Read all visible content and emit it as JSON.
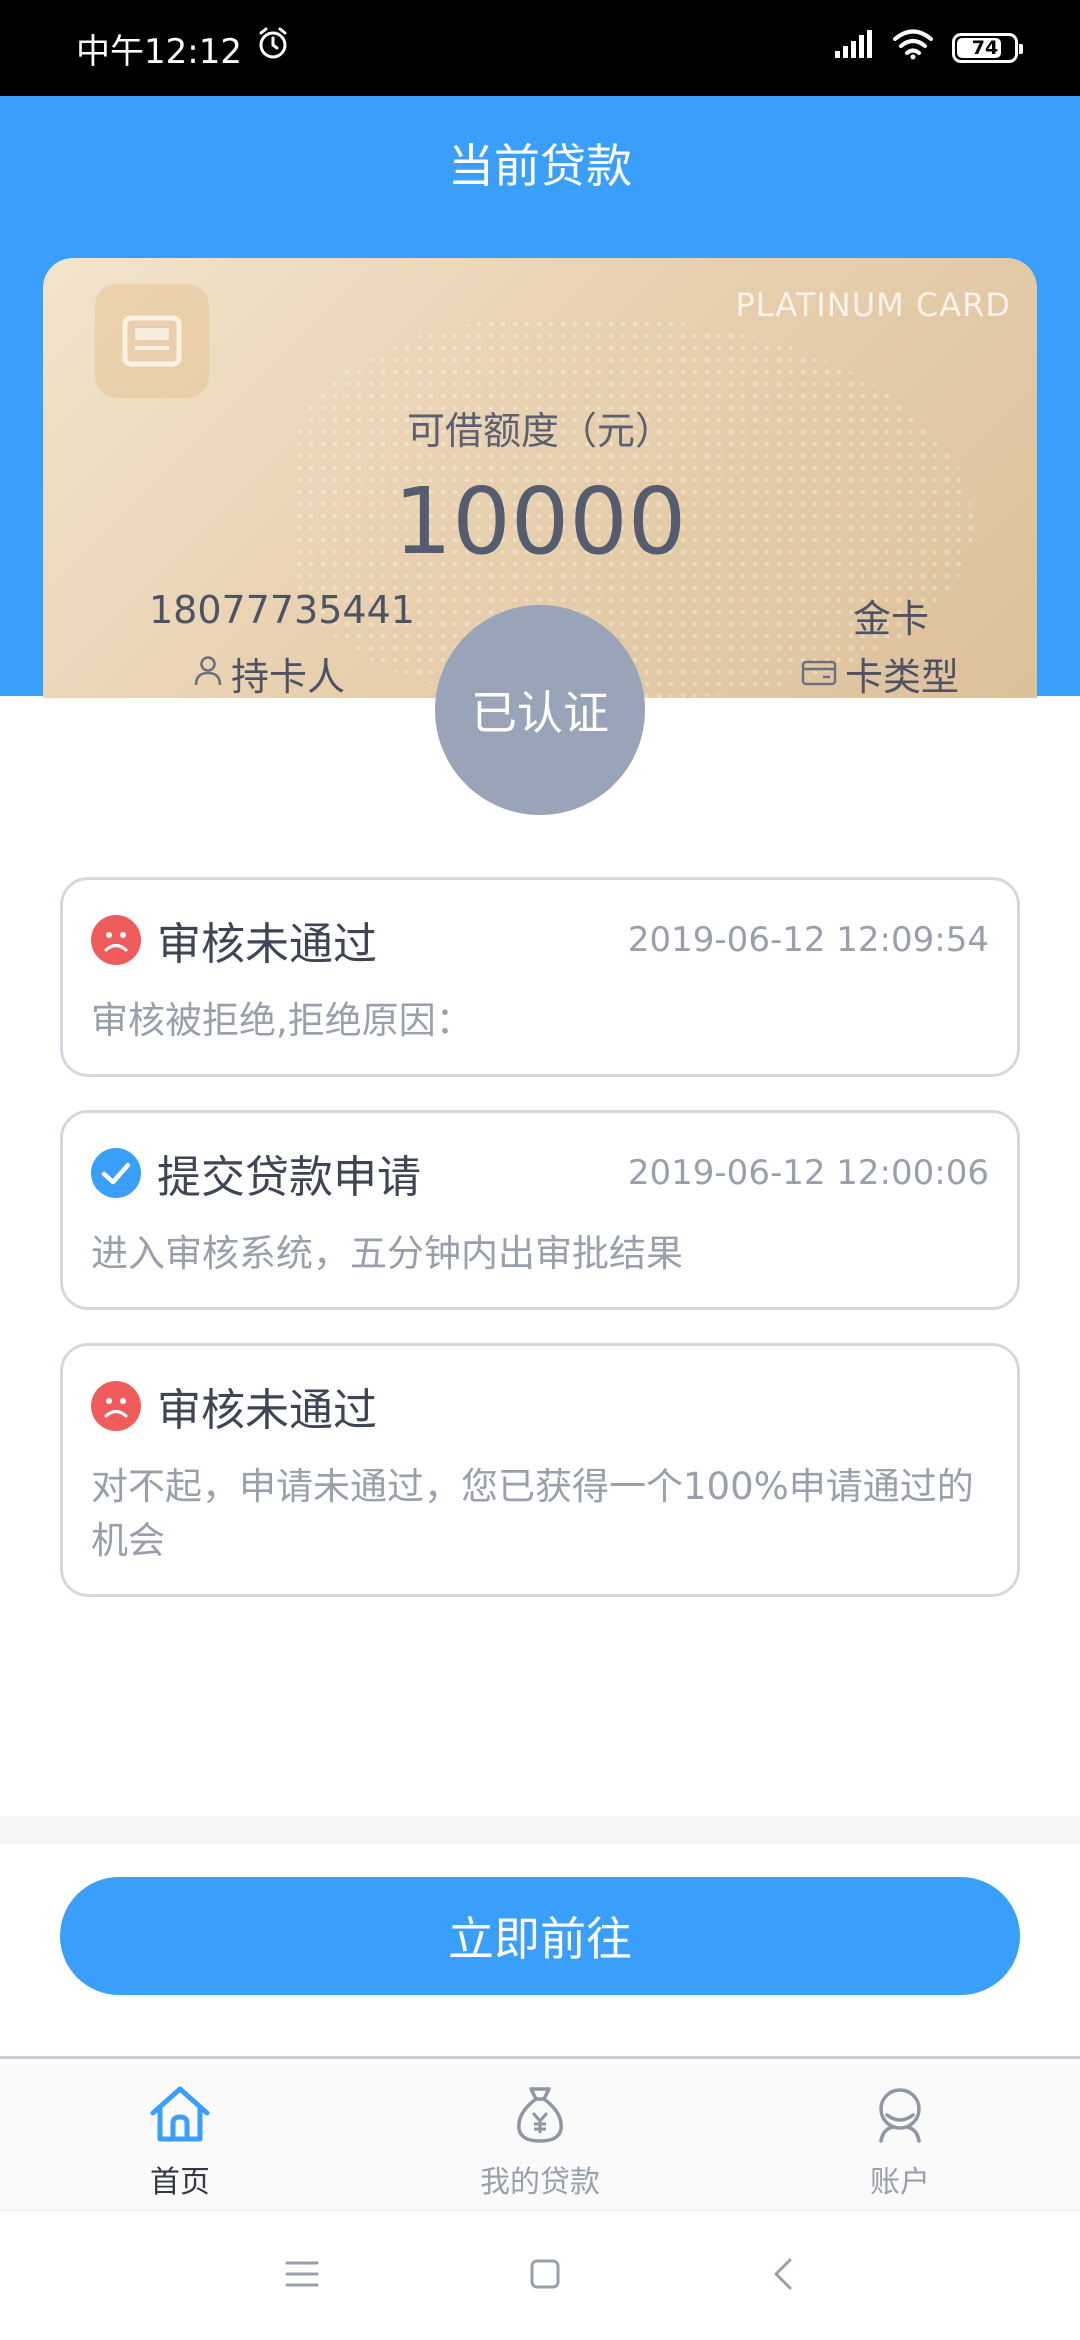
{
  "status_bar": {
    "time": "中午12:12",
    "battery": "74"
  },
  "header": {
    "title": "当前贷款"
  },
  "card": {
    "brand": "PLATINUM CARD",
    "label": "可借额度（元）",
    "amount": "10000",
    "phone": "18077735441",
    "holder_label": "持卡人",
    "type_value": "金卡",
    "type_label": "卡类型"
  },
  "verified": "已认证",
  "records": [
    {
      "status": "rejected",
      "title": "审核未通过",
      "time": "2019-06-12 12:09:54",
      "desc": "审核被拒绝,拒绝原因："
    },
    {
      "status": "submitted",
      "title": "提交贷款申请",
      "time": "2019-06-12 12:00:06",
      "desc": "进入审核系统，五分钟内出审批结果"
    },
    {
      "status": "rejected",
      "title": "审核未通过",
      "time": "",
      "desc": "对不起，申请未通过，您已获得一个100%申请通过的机会"
    }
  ],
  "action_button": "立即前往",
  "bottom_nav": [
    {
      "label": "首页",
      "icon": "home-icon",
      "active": true
    },
    {
      "label": "我的贷款",
      "icon": "money-bag-icon",
      "active": false
    },
    {
      "label": "账户",
      "icon": "user-icon",
      "active": false
    }
  ],
  "colors": {
    "primary": "#399ffb",
    "rejected": "#f05b5b",
    "badge": "#9aa4b8"
  }
}
